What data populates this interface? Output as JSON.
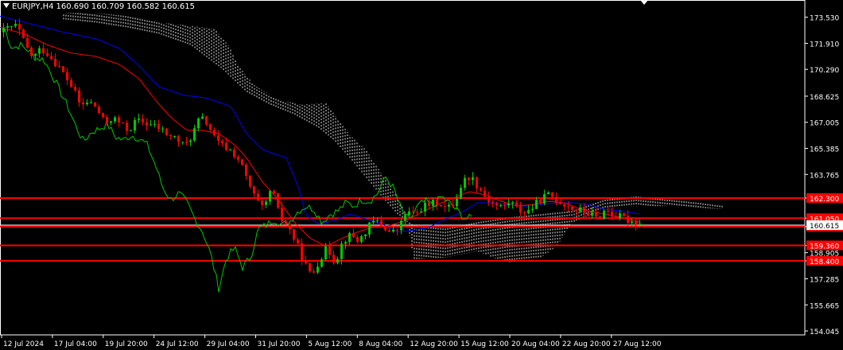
{
  "header": {
    "symbol": "EURJPY,H4",
    "open": "160.690",
    "high": "160.709",
    "low": "160.582",
    "close": "160.615"
  },
  "colors": {
    "background": "#000000",
    "axis": "#ffffff",
    "bull_candle": "#00c800",
    "bear_candle": "#ff0000",
    "tenkan": "#ff0000",
    "kijun": "#0000ff",
    "chikou": "#00c800",
    "cloud": "#ffffff",
    "level_line": "#ff0000",
    "price_line": "#ffffff"
  },
  "chart_data": {
    "type": "candlestick",
    "symbol": "EURJPY",
    "timeframe": "H4",
    "ylim": [
      153.8,
      174.6
    ],
    "y_ticks": [
      "173.530",
      "171.910",
      "170.290",
      "168.625",
      "167.005",
      "165.385",
      "163.765",
      "162.300",
      "161.050",
      "160.530",
      "159.360",
      "158.905",
      "158.400",
      "157.285",
      "155.665",
      "154.045"
    ],
    "x_ticks": [
      "12 Jul 2024",
      "17 Jul 04:00",
      "19 Jul 20:00",
      "24 Jul 12:00",
      "29 Jul 04:00",
      "31 Jul 20:00",
      "5 Aug 12:00",
      "8 Aug 04:00",
      "12 Aug 20:00",
      "15 Aug 12:00",
      "20 Aug 04:00",
      "22 Aug 20:00",
      "27 Aug 12:00"
    ],
    "current_price": "160.615",
    "levels": [
      {
        "value": 162.3,
        "label": "162.300"
      },
      {
        "value": 161.05,
        "label": "161.050"
      },
      {
        "value": 160.53,
        "label": "160.530"
      },
      {
        "value": 159.36,
        "label": "159.360"
      },
      {
        "value": 158.4,
        "label": "158.400"
      }
    ],
    "anchors": {
      "close": [
        [
          0,
          172.6
        ],
        [
          10,
          172.9
        ],
        [
          20,
          173.0
        ],
        [
          30,
          171.8
        ],
        [
          40,
          171.0
        ],
        [
          50,
          171.6
        ],
        [
          60,
          171.2
        ],
        [
          70,
          170.6
        ],
        [
          80,
          169.9
        ],
        [
          90,
          169.1
        ],
        [
          100,
          168.0
        ],
        [
          110,
          168.3
        ],
        [
          120,
          167.9
        ],
        [
          130,
          166.9
        ],
        [
          140,
          167.3
        ],
        [
          150,
          166.9
        ],
        [
          160,
          166.5
        ],
        [
          170,
          167.1
        ],
        [
          180,
          167.0
        ],
        [
          190,
          166.8
        ],
        [
          200,
          166.6
        ],
        [
          210,
          166.2
        ],
        [
          220,
          166.0
        ],
        [
          230,
          165.5
        ],
        [
          240,
          166.2
        ],
        [
          250,
          167.3
        ],
        [
          260,
          166.9
        ],
        [
          270,
          165.8
        ],
        [
          280,
          165.5
        ],
        [
          290,
          165.2
        ],
        [
          300,
          164.6
        ],
        [
          310,
          163.3
        ],
        [
          320,
          162.2
        ],
        [
          330,
          161.5
        ],
        [
          340,
          163.0
        ],
        [
          350,
          161.1
        ],
        [
          360,
          160.6
        ],
        [
          370,
          159.6
        ],
        [
          380,
          158.4
        ],
        [
          390,
          157.4
        ],
        [
          400,
          158.5
        ],
        [
          410,
          159.2
        ],
        [
          420,
          158.3
        ],
        [
          430,
          159.7
        ],
        [
          440,
          160.0
        ],
        [
          450,
          159.6
        ],
        [
          460,
          160.4
        ],
        [
          470,
          160.9
        ],
        [
          480,
          160.6
        ],
        [
          490,
          160.1
        ],
        [
          500,
          160.4
        ],
        [
          510,
          161.5
        ],
        [
          520,
          161.2
        ],
        [
          530,
          161.8
        ],
        [
          540,
          161.9
        ],
        [
          550,
          162.1
        ],
        [
          560,
          161.6
        ],
        [
          570,
          162.0
        ],
        [
          580,
          163.3
        ],
        [
          590,
          163.7
        ],
        [
          600,
          163.0
        ],
        [
          610,
          162.3
        ],
        [
          620,
          161.9
        ],
        [
          630,
          161.7
        ],
        [
          640,
          162.1
        ],
        [
          650,
          161.6
        ],
        [
          660,
          161.4
        ],
        [
          670,
          161.8
        ],
        [
          680,
          162.3
        ],
        [
          690,
          162.5
        ],
        [
          700,
          162.1
        ],
        [
          710,
          161.9
        ],
        [
          720,
          161.6
        ],
        [
          730,
          161.5
        ],
        [
          740,
          161.3
        ],
        [
          750,
          161.0
        ],
        [
          760,
          161.6
        ],
        [
          770,
          161.2
        ],
        [
          780,
          161.1
        ],
        [
          790,
          160.9
        ],
        [
          800,
          160.8
        ],
        [
          805,
          160.6
        ]
      ],
      "chikou": [
        [
          5,
          172.9
        ],
        [
          15,
          171.6
        ],
        [
          25,
          171.8
        ],
        [
          35,
          171.5
        ],
        [
          45,
          171.0
        ],
        [
          55,
          170.9
        ],
        [
          65,
          170.0
        ],
        [
          75,
          169.0
        ],
        [
          85,
          168.0
        ],
        [
          95,
          166.8
        ],
        [
          105,
          165.8
        ],
        [
          115,
          166.4
        ],
        [
          125,
          166.6
        ],
        [
          135,
          166.9
        ],
        [
          145,
          166.1
        ],
        [
          155,
          165.9
        ],
        [
          165,
          166.2
        ],
        [
          175,
          166.0
        ],
        [
          185,
          165.6
        ],
        [
          195,
          164.4
        ],
        [
          205,
          162.9
        ],
        [
          215,
          162.2
        ],
        [
          225,
          162.6
        ],
        [
          235,
          162.0
        ],
        [
          245,
          161.0
        ],
        [
          255,
          160.2
        ],
        [
          265,
          158.8
        ],
        [
          275,
          156.7
        ],
        [
          285,
          158.6
        ],
        [
          295,
          159.2
        ],
        [
          305,
          158.0
        ],
        [
          315,
          158.6
        ],
        [
          325,
          160.4
        ],
        [
          335,
          160.6
        ],
        [
          345,
          161.0
        ],
        [
          355,
          160.6
        ],
        [
          365,
          160.9
        ],
        [
          375,
          161.5
        ],
        [
          385,
          161.8
        ],
        [
          395,
          161.6
        ],
        [
          405,
          160.8
        ],
        [
          415,
          161.3
        ],
        [
          425,
          161.5
        ],
        [
          435,
          162.0
        ],
        [
          445,
          161.8
        ],
        [
          455,
          162.2
        ],
        [
          465,
          162.1
        ],
        [
          475,
          162.6
        ],
        [
          485,
          163.6
        ],
        [
          495,
          162.9
        ],
        [
          505,
          161.5
        ],
        [
          515,
          160.9
        ],
        [
          525,
          161.8
        ],
        [
          535,
          162.1
        ],
        [
          545,
          161.8
        ],
        [
          555,
          162.4
        ],
        [
          565,
          162.0
        ],
        [
          575,
          161.5
        ],
        [
          585,
          161.0
        ],
        [
          595,
          161.1
        ]
      ],
      "tenkan": [
        [
          0,
          172.9
        ],
        [
          30,
          172.5
        ],
        [
          60,
          171.8
        ],
        [
          90,
          171.3
        ],
        [
          120,
          171.1
        ],
        [
          150,
          170.6
        ],
        [
          175,
          169.7
        ],
        [
          195,
          168.4
        ],
        [
          215,
          167.3
        ],
        [
          235,
          166.5
        ],
        [
          255,
          166.5
        ],
        [
          275,
          166.3
        ],
        [
          295,
          165.6
        ],
        [
          310,
          164.8
        ],
        [
          330,
          163.3
        ],
        [
          350,
          162.2
        ],
        [
          370,
          160.8
        ],
        [
          390,
          159.8
        ],
        [
          410,
          159.3
        ],
        [
          430,
          159.8
        ],
        [
          450,
          160.2
        ],
        [
          470,
          160.5
        ],
        [
          490,
          160.6
        ],
        [
          510,
          160.9
        ],
        [
          530,
          161.4
        ],
        [
          550,
          161.9
        ],
        [
          570,
          162.3
        ],
        [
          590,
          162.7
        ],
        [
          610,
          162.5
        ],
        [
          630,
          162.1
        ],
        [
          650,
          161.8
        ],
        [
          670,
          161.9
        ],
        [
          690,
          162.1
        ],
        [
          710,
          162.0
        ],
        [
          730,
          161.6
        ],
        [
          750,
          161.4
        ],
        [
          770,
          161.2
        ],
        [
          790,
          161.0
        ],
        [
          805,
          160.8
        ]
      ],
      "kijun": [
        [
          0,
          173.6
        ],
        [
          40,
          173.1
        ],
        [
          80,
          172.6
        ],
        [
          120,
          172.2
        ],
        [
          150,
          171.6
        ],
        [
          175,
          170.5
        ],
        [
          200,
          169.2
        ],
        [
          230,
          168.7
        ],
        [
          260,
          168.5
        ],
        [
          290,
          168.0
        ],
        [
          310,
          166.3
        ],
        [
          330,
          165.3
        ],
        [
          360,
          164.8
        ],
        [
          375,
          163.0
        ],
        [
          385,
          161.2
        ],
        [
          400,
          160.7
        ],
        [
          420,
          160.9
        ],
        [
          440,
          161.3
        ],
        [
          460,
          161.0
        ],
        [
          480,
          160.7
        ],
        [
          500,
          160.2
        ],
        [
          520,
          160.3
        ],
        [
          540,
          160.5
        ],
        [
          560,
          161.0
        ],
        [
          580,
          161.4
        ],
        [
          600,
          162.0
        ],
        [
          620,
          162.0
        ],
        [
          640,
          161.9
        ],
        [
          660,
          161.8
        ],
        [
          680,
          161.9
        ],
        [
          700,
          162.0
        ],
        [
          720,
          162.0
        ],
        [
          740,
          161.9
        ],
        [
          760,
          161.6
        ],
        [
          780,
          161.5
        ],
        [
          805,
          161.3
        ]
      ],
      "span_a": [
        [
          80,
          173.4
        ],
        [
          120,
          173.2
        ],
        [
          160,
          172.9
        ],
        [
          200,
          172.5
        ],
        [
          240,
          171.8
        ],
        [
          280,
          170.3
        ],
        [
          310,
          168.9
        ],
        [
          340,
          168.1
        ],
        [
          370,
          167.5
        ],
        [
          400,
          166.7
        ],
        [
          420,
          165.9
        ],
        [
          440,
          164.8
        ],
        [
          460,
          163.6
        ],
        [
          480,
          162.4
        ],
        [
          500,
          161.3
        ],
        [
          520,
          160.6
        ],
        [
          560,
          160.4
        ],
        [
          600,
          160.8
        ],
        [
          640,
          161.1
        ],
        [
          680,
          161.3
        ],
        [
          720,
          161.5
        ],
        [
          760,
          162.2
        ],
        [
          800,
          162.4
        ],
        [
          840,
          162.2
        ],
        [
          880,
          162.0
        ],
        [
          910,
          161.8
        ]
      ],
      "span_b": [
        [
          80,
          173.8
        ],
        [
          120,
          173.8
        ],
        [
          160,
          173.6
        ],
        [
          200,
          173.2
        ],
        [
          240,
          173.0
        ],
        [
          270,
          172.8
        ],
        [
          290,
          171.6
        ],
        [
          300,
          170.5
        ],
        [
          320,
          169.3
        ],
        [
          350,
          168.4
        ],
        [
          380,
          168.1
        ],
        [
          410,
          168.2
        ],
        [
          440,
          166.2
        ],
        [
          460,
          165.3
        ],
        [
          480,
          163.8
        ],
        [
          500,
          162.3
        ],
        [
          510,
          161.4
        ],
        [
          520,
          158.5
        ],
        [
          560,
          158.6
        ],
        [
          600,
          159.0
        ],
        [
          620,
          158.6
        ],
        [
          640,
          158.3
        ],
        [
          680,
          158.6
        ],
        [
          700,
          159.3
        ],
        [
          720,
          160.8
        ],
        [
          760,
          161.6
        ],
        [
          800,
          161.8
        ],
        [
          840,
          161.8
        ],
        [
          880,
          161.7
        ],
        [
          910,
          161.6
        ]
      ]
    }
  }
}
